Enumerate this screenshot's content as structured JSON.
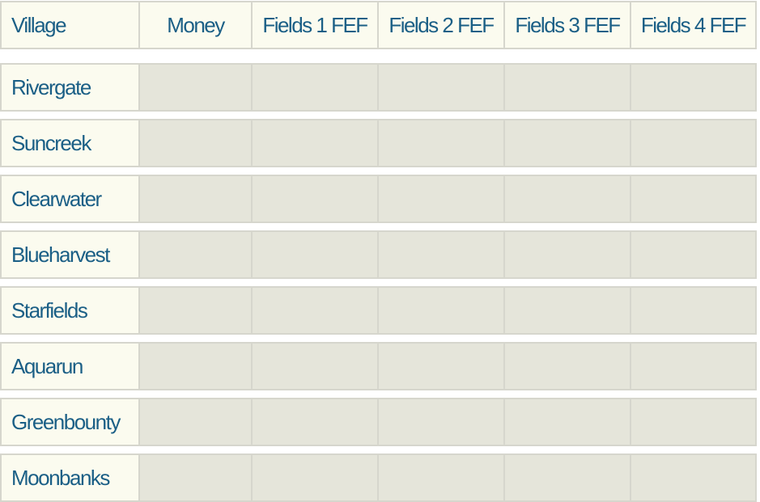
{
  "table": {
    "headers": [
      "Village",
      "Money",
      "Fields 1 FEF",
      "Fields 2 FEF",
      "Fields 3 FEF",
      "Fields 4 FEF"
    ],
    "rows": [
      {
        "village": "Rivergate",
        "cells": [
          "",
          "",
          "",
          "",
          ""
        ]
      },
      {
        "village": "Suncreek",
        "cells": [
          "",
          "",
          "",
          "",
          ""
        ]
      },
      {
        "village": "Clearwater",
        "cells": [
          "",
          "",
          "",
          "",
          ""
        ]
      },
      {
        "village": "Blueharvest",
        "cells": [
          "",
          "",
          "",
          "",
          ""
        ]
      },
      {
        "village": "Starfields",
        "cells": [
          "",
          "",
          "",
          "",
          ""
        ]
      },
      {
        "village": "Aquarun",
        "cells": [
          "",
          "",
          "",
          "",
          ""
        ]
      },
      {
        "village": "Greenbounty",
        "cells": [
          "",
          "",
          "",
          "",
          ""
        ]
      },
      {
        "village": "Moonbanks",
        "cells": [
          "",
          "",
          "",
          "",
          ""
        ]
      }
    ]
  },
  "colors": {
    "header_bg": "#fbfbef",
    "cell_bg": "#e5e5da",
    "border": "#d6d6cd",
    "text": "#1b5f86"
  }
}
